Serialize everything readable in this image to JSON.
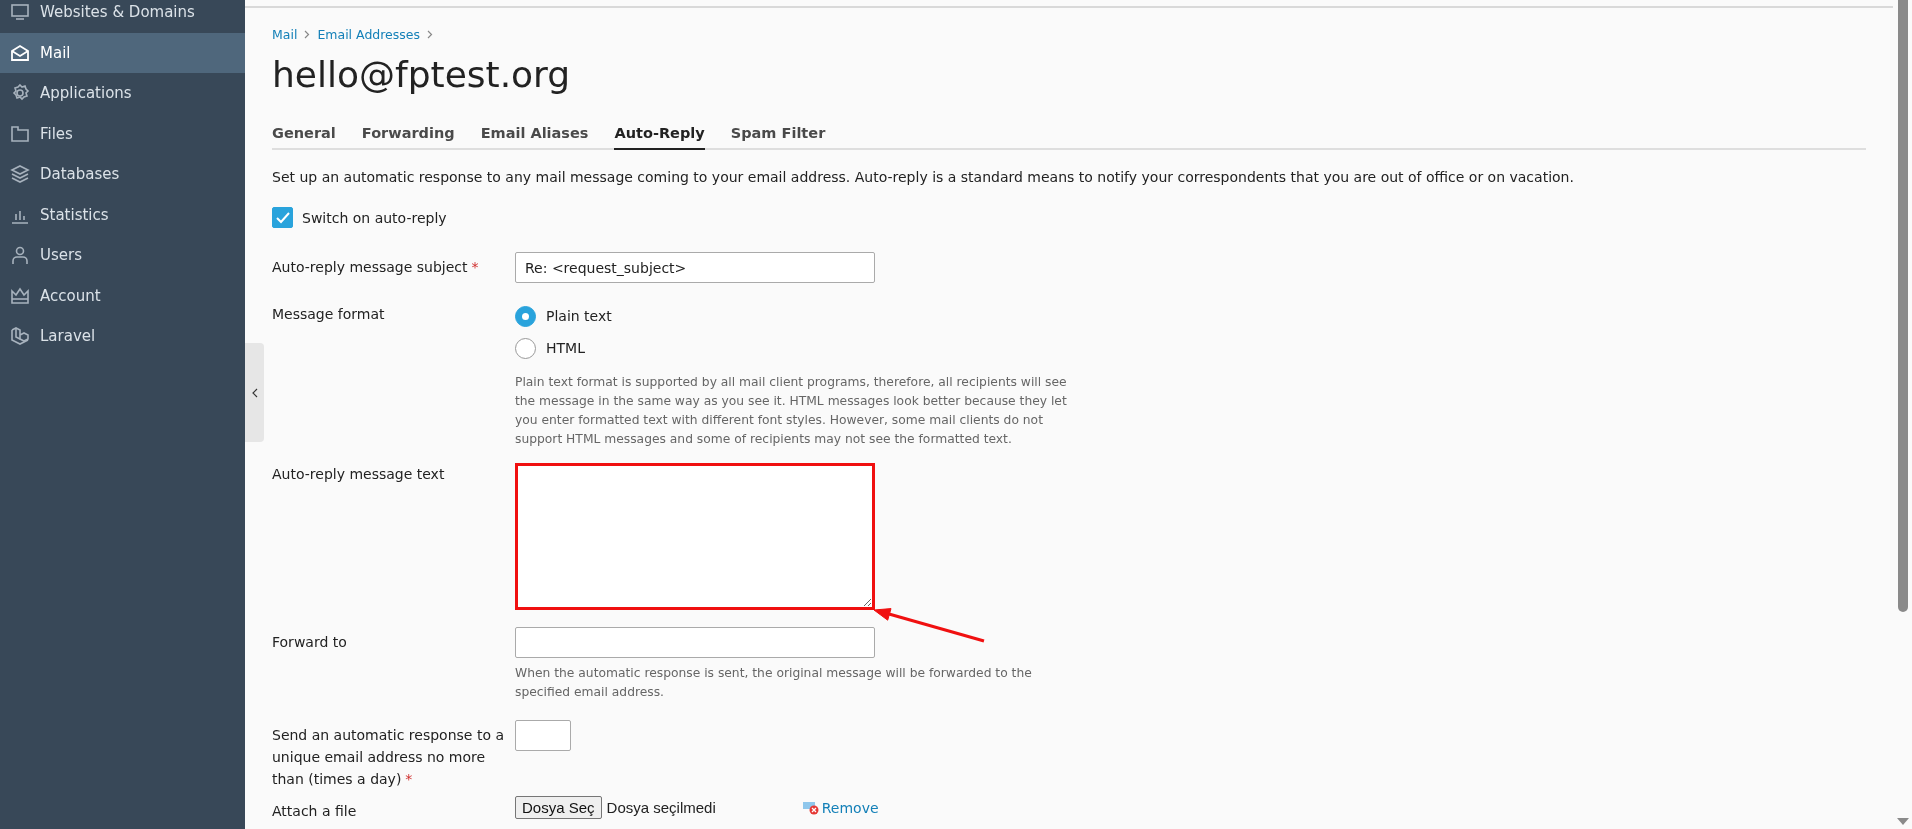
{
  "sidebar": {
    "items": [
      {
        "label": "Websites & Domains",
        "selected": false
      },
      {
        "label": "Mail",
        "selected": true
      },
      {
        "label": "Applications",
        "selected": false
      },
      {
        "label": "Files",
        "selected": false
      },
      {
        "label": "Databases",
        "selected": false
      },
      {
        "label": "Statistics",
        "selected": false
      },
      {
        "label": "Users",
        "selected": false
      },
      {
        "label": "Account",
        "selected": false
      },
      {
        "label": "Laravel",
        "selected": false
      }
    ]
  },
  "breadcrumb": [
    "Mail",
    "Email Addresses"
  ],
  "title": "hello@fptest.org",
  "tabs": [
    {
      "label": "General",
      "selected": false
    },
    {
      "label": "Forwarding",
      "selected": false
    },
    {
      "label": "Email Aliases",
      "selected": false
    },
    {
      "label": "Auto-Reply",
      "selected": true
    },
    {
      "label": "Spam Filter",
      "selected": false
    }
  ],
  "description": "Set up an automatic response to any mail message coming to your email address. Auto-reply is a standard means to notify your correspondents that you are out of office or on vacation.",
  "auto_reply_switch": {
    "label": "Switch on auto-reply",
    "checked": true
  },
  "required_mark": "*",
  "fields": [
    {
      "kind": "text",
      "label": "Auto-reply message subject",
      "required": true,
      "value": "Re: <request_subject>"
    },
    {
      "kind": "radio",
      "label": "Message format",
      "required": false,
      "options": [
        {
          "label": "Plain text",
          "selected": true
        },
        {
          "label": "HTML",
          "selected": false
        }
      ],
      "hint": "Plain text format is supported by all mail client programs, therefore, all recipients will see the message in the same way as you see it. HTML messages look better because they let you enter formatted text with different font styles. However, some mail clients do not support HTML messages and some of recipients may not see the formatted text."
    },
    {
      "kind": "textarea",
      "label": "Auto-reply message text",
      "required": false,
      "highlighted": true
    },
    {
      "kind": "text",
      "label": "Forward to",
      "required": false,
      "hint": "When the automatic response is sent, the original message will be forwarded to the specified email address."
    },
    {
      "kind": "number",
      "label": "Send an automatic response to a unique email address no more than (times a day)",
      "required": true
    },
    {
      "kind": "file",
      "label": "Attach a file",
      "required": false,
      "button": "Dosya Seç",
      "status": "Dosya seçilmedi",
      "remove": "Remove"
    }
  ]
}
